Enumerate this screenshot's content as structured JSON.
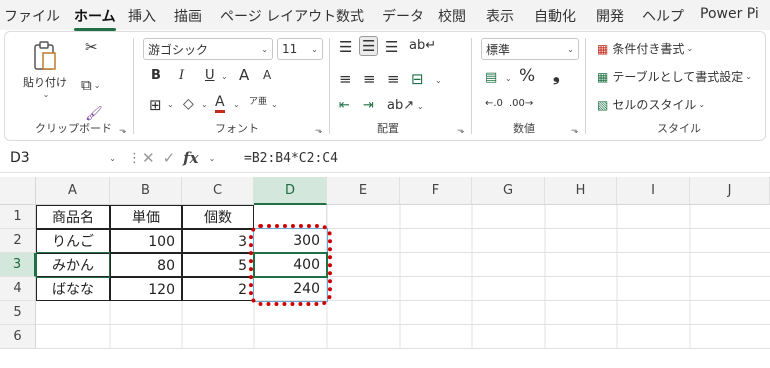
{
  "menu": {
    "tabs": [
      {
        "label": "ファイル",
        "active": false
      },
      {
        "label": "ホーム",
        "active": true
      },
      {
        "label": "挿入",
        "active": false
      },
      {
        "label": "描画",
        "active": false
      },
      {
        "label": "ページ レイアウト",
        "active": false
      },
      {
        "label": "数式",
        "active": false
      },
      {
        "label": "データ",
        "active": false
      },
      {
        "label": "校閲",
        "active": false
      },
      {
        "label": "表示",
        "active": false
      },
      {
        "label": "自動化",
        "active": false
      },
      {
        "label": "開発",
        "active": false
      },
      {
        "label": "ヘルプ",
        "active": false
      },
      {
        "label": "Power Pi",
        "active": false
      }
    ]
  },
  "ribbon": {
    "clipboard": {
      "label": "クリップボード",
      "paste_label": "貼り付け",
      "icons": [
        "paste-icon",
        "cut-icon",
        "copy-icon",
        "format-painter-icon"
      ]
    },
    "font": {
      "label": "フォント",
      "font_name": "游ゴシック",
      "font_size": "11",
      "bold": "B",
      "italic": "I",
      "underline": "U",
      "grow": "A",
      "shrink": "A",
      "font_color": "A",
      "phonetic": "ア亜"
    },
    "alignment": {
      "label": "配置",
      "icons": [
        "align-top-icon",
        "align-middle-icon",
        "align-bottom-icon",
        "wrap-text-icon",
        "align-left-icon",
        "align-center-icon",
        "align-right-icon",
        "merge-center-icon",
        "decrease-indent-icon",
        "increase-indent-icon",
        "orientation-icon"
      ]
    },
    "number": {
      "label": "数値",
      "format": "標準",
      "percent": "%",
      "comma": "❟"
    },
    "styles": {
      "label": "スタイル",
      "conditional": "条件付き書式",
      "table": "テーブルとして書式設定",
      "cell_styles": "セルのスタイル"
    }
  },
  "formula_bar": {
    "name_box": "D3",
    "formula": "=B2:B4*C2:C4"
  },
  "sheet": {
    "columns": [
      "A",
      "B",
      "C",
      "D",
      "E",
      "F",
      "G",
      "H",
      "I",
      "J"
    ],
    "rows": [
      "1",
      "2",
      "3",
      "4",
      "5",
      "6"
    ],
    "cells": {
      "A1": "商品名",
      "B1": "単価",
      "C1": "個数",
      "A2": "りんご",
      "B2": "100",
      "C2": "3",
      "D2": "300",
      "A3": "みかん",
      "B3": "80",
      "C3": "5",
      "D3": "400",
      "A4": "ばなな",
      "B4": "120",
      "C4": "2",
      "D4": "240"
    },
    "selected_column": "D",
    "selected_row": "3",
    "active_cell": "D3"
  },
  "colors": {
    "accent": "#1f7145",
    "highlight": "#d00000"
  }
}
